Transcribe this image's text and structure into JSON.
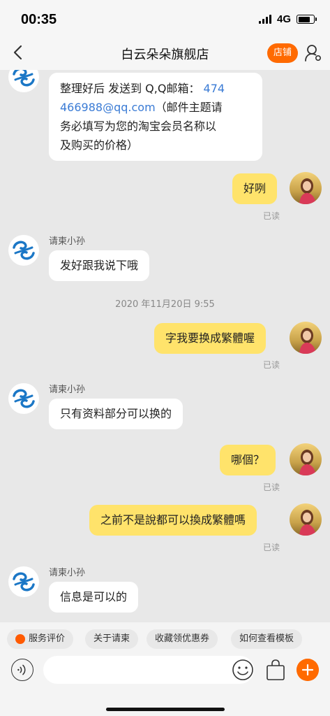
{
  "status_bar": {
    "time": "00:35",
    "network": "4G"
  },
  "header": {
    "title": "白云朵朵旗舰店",
    "shop_button": "店铺"
  },
  "messages": {
    "m1": {
      "line1_text": "整理好后 发送到 Q,Q邮箱：",
      "line1_link": "474",
      "line2_link": "466988@qq.com",
      "line2_text": "（邮件主题请",
      "line3": "务必填写为您的淘宝会员名称以",
      "line4": "及购买的价格）"
    },
    "m2": {
      "text": "好咧",
      "status": "已读"
    },
    "m3": {
      "sender": "请柬小孙",
      "text": "发好跟我说下哦"
    },
    "timestamp": "2020 年11月20日 9:55",
    "m4": {
      "text": "字我要换成繁體喔",
      "status": "已读"
    },
    "m5": {
      "sender": "请柬小孙",
      "text": "只有资料部分可以换的"
    },
    "m6": {
      "text": "哪個？",
      "status": "已读"
    },
    "m7": {
      "text": "之前不是說都可以換成繁體嗎",
      "status": "已读"
    },
    "m8": {
      "sender": "请柬小孙",
      "text": "信息是可以的"
    }
  },
  "quick_replies": [
    "服务评价",
    "关于请柬",
    "收藏领优惠券",
    "如何查看模板"
  ],
  "colors": {
    "accent": "#ff6a00",
    "out_bubble": "#ffe36b",
    "link": "#3a7bd5"
  }
}
